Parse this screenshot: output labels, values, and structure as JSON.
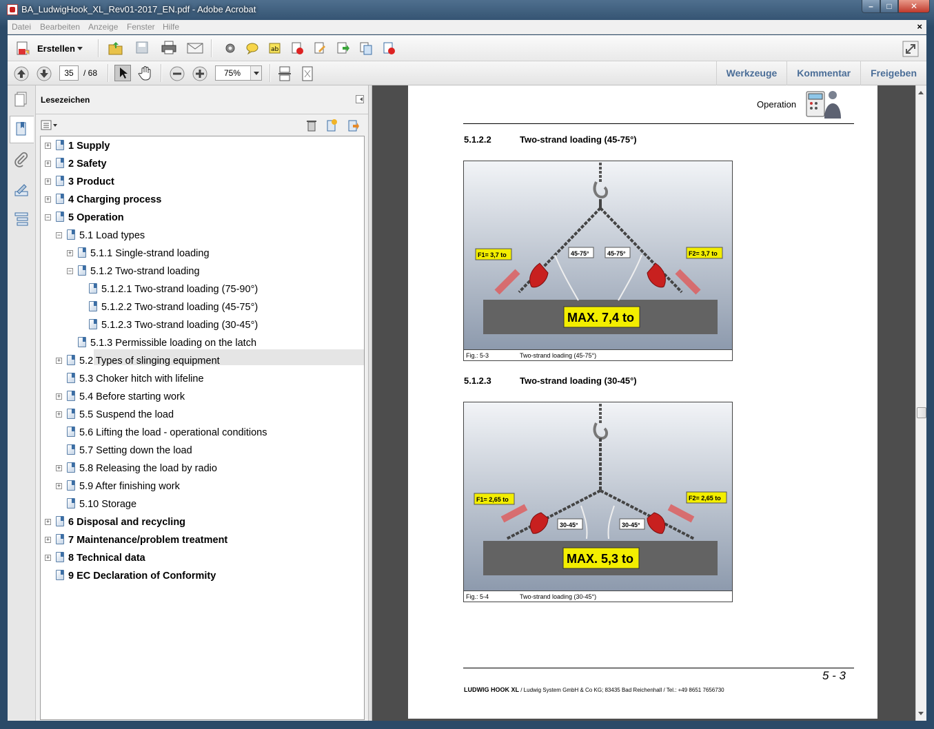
{
  "window": {
    "title": "BA_LudwigHook_XL_Rev01-2017_EN.pdf - Adobe Acrobat"
  },
  "menu": [
    "Datei",
    "Bearbeiten",
    "Anzeige",
    "Fenster",
    "Hilfe"
  ],
  "toolbar": {
    "create_label": "Erstellen",
    "page_current": "35",
    "page_total": "/ 68",
    "zoom": "75%",
    "right_links": [
      "Werkzeuge",
      "Kommentar",
      "Freigeben"
    ]
  },
  "bookmarks": {
    "header": "Lesezeichen",
    "items": [
      {
        "label": "1 Supply",
        "level": 0,
        "toggle": "+"
      },
      {
        "label": "2 Safety",
        "level": 0,
        "toggle": "+"
      },
      {
        "label": "3 Product",
        "level": 0,
        "toggle": "+"
      },
      {
        "label": "4 Charging process",
        "level": 0,
        "toggle": "+"
      },
      {
        "label": "5 Operation",
        "level": 0,
        "toggle": "-"
      },
      {
        "label": "5.1 Load types",
        "level": 1,
        "toggle": "-"
      },
      {
        "label": "5.1.1 Single-strand loading",
        "level": 2,
        "toggle": "+"
      },
      {
        "label": "5.1.2 Two-strand loading",
        "level": 2,
        "toggle": "-"
      },
      {
        "label": "5.1.2.1 Two-strand loading (75-90°)",
        "level": 3,
        "toggle": ""
      },
      {
        "label": "5.1.2.2 Two-strand loading (45-75°)",
        "level": 3,
        "toggle": "",
        "selected": true
      },
      {
        "label": "5.1.2.3 Two-strand loading (30-45°)",
        "level": 3,
        "toggle": ""
      },
      {
        "label": "5.1.3 Permissible loading on the latch",
        "level": 2,
        "toggle": ""
      },
      {
        "label": "5.2 Types of slinging equipment",
        "level": 1,
        "toggle": "+"
      },
      {
        "label": "5.3 Choker hitch with lifeline",
        "level": 1,
        "toggle": ""
      },
      {
        "label": "5.4 Before starting work",
        "level": 1,
        "toggle": "+"
      },
      {
        "label": "5.5 Suspend the load",
        "level": 1,
        "toggle": "+"
      },
      {
        "label": "5.6 Lifting the load - operational conditions",
        "level": 1,
        "toggle": ""
      },
      {
        "label": "5.7 Setting down the load",
        "level": 1,
        "toggle": ""
      },
      {
        "label": "5.8 Releasing the load by radio",
        "level": 1,
        "toggle": "+"
      },
      {
        "label": "5.9 After finishing work",
        "level": 1,
        "toggle": "+"
      },
      {
        "label": "5.10 Storage",
        "level": 1,
        "toggle": ""
      },
      {
        "label": "6 Disposal and recycling",
        "level": 0,
        "toggle": "+"
      },
      {
        "label": "7 Maintenance/problem treatment",
        "level": 0,
        "toggle": "+"
      },
      {
        "label": "8 Technical data",
        "level": 0,
        "toggle": "+"
      },
      {
        "label": "9 EC Declaration of Conformity",
        "level": 0,
        "toggle": ""
      }
    ]
  },
  "page": {
    "header": "Operation",
    "section1": {
      "num": "5.1.2.2",
      "title": "Two-strand loading (45-75°)"
    },
    "figure1": {
      "f1": "F1= 3,7 to",
      "f2": "F2= 3,7 to",
      "angle_left": "45-75°",
      "angle_right": "45-75°",
      "max": "MAX. 7,4 to",
      "caption_num": "Fig.: 5-3",
      "caption_text": "Two-strand loading (45-75°)"
    },
    "section2": {
      "num": "5.1.2.3",
      "title": "Two-strand loading (30-45°)"
    },
    "figure2": {
      "f1": "F1= 2,65 to",
      "f2": "F2= 2,65 to",
      "angle_left": "30-45°",
      "angle_right": "30-45°",
      "max": "MAX. 5,3 to",
      "caption_num": "Fig.: 5-4",
      "caption_text": "Two-strand loading (30-45°)"
    },
    "page_number": "5 - 3",
    "footer_brand": "LUDWIG HOOK XL",
    "footer_text": " / Ludwig System GmbH & Co KG; 83435 Bad Reichenhall / Tel.: +49 8651 7656730"
  }
}
